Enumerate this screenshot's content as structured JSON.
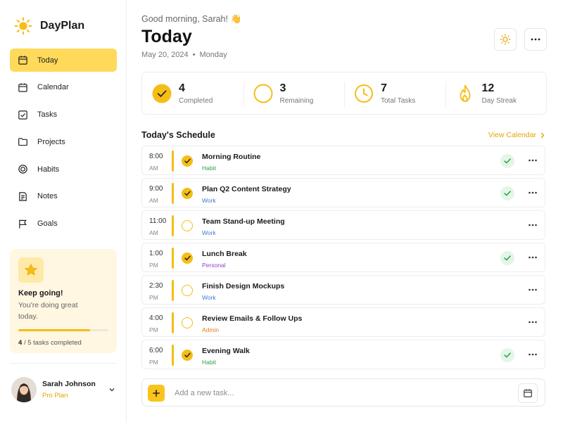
{
  "app": {
    "name": "DayPlan",
    "logo_icon": "sun-icon",
    "accent": "#F5BD16",
    "active_bg": "#FFD95A"
  },
  "sidebar": {
    "items": [
      {
        "label": "Today",
        "icon": "calendar-icon",
        "active": true
      },
      {
        "label": "Calendar",
        "icon": "calendar-icon",
        "active": false
      },
      {
        "label": "Tasks",
        "icon": "checkbox-icon",
        "active": false
      },
      {
        "label": "Projects",
        "icon": "folder-icon",
        "active": false
      },
      {
        "label": "Habits",
        "icon": "target-icon",
        "active": false
      },
      {
        "label": "Notes",
        "icon": "note-icon",
        "active": false
      },
      {
        "label": "Goals",
        "icon": "flag-icon",
        "active": false
      }
    ],
    "motivation": {
      "title": "Keep going!",
      "body": "You're doing great today.",
      "icon": "star-icon",
      "progress_done": "4",
      "progress_total": "5",
      "progress_suffix": "tasks completed",
      "progress_fraction": 0.8
    },
    "user": {
      "name": "Sarah Johnson",
      "plan": "Pro Plan"
    }
  },
  "header": {
    "greeting": "Good morning, Sarah! 👋",
    "title": "Today",
    "date": "May 20, 2024",
    "weekday": "Monday",
    "separator": "•"
  },
  "stats": [
    {
      "value": "4",
      "label": "Completed",
      "icon": "check-circle-icon"
    },
    {
      "value": "3",
      "label": "Remaining",
      "icon": "circle-icon"
    },
    {
      "value": "7",
      "label": "Total Tasks",
      "icon": "clock-icon"
    },
    {
      "value": "12",
      "label": "Day Streak",
      "icon": "flame-icon"
    }
  ],
  "schedule": {
    "title": "Today's Schedule",
    "view_link": "View Calendar",
    "rows": [
      {
        "time": "8:00",
        "ampm": "AM",
        "title": "Morning Routine",
        "tag": "Habit",
        "tag_color": "#2E9E48",
        "done": true
      },
      {
        "time": "9:00",
        "ampm": "AM",
        "title": "Plan Q2 Content Strategy",
        "tag": "Work",
        "tag_color": "#3A7BD5",
        "done": true
      },
      {
        "time": "11:00",
        "ampm": "AM",
        "title": "Team Stand-up Meeting",
        "tag": "Work",
        "tag_color": "#3A7BD5",
        "done": false
      },
      {
        "time": "1:00",
        "ampm": "PM",
        "title": "Lunch Break",
        "tag": "Personal",
        "tag_color": "#8E44C8",
        "done": true
      },
      {
        "time": "2:30",
        "ampm": "PM",
        "title": "Finish Design Mockups",
        "tag": "Work",
        "tag_color": "#3A7BD5",
        "done": false
      },
      {
        "time": "4:00",
        "ampm": "PM",
        "title": "Review Emails & Follow Ups",
        "tag": "Admin",
        "tag_color": "#E07B1F",
        "done": false
      },
      {
        "time": "6:00",
        "ampm": "PM",
        "title": "Evening Walk",
        "tag": "Habit",
        "tag_color": "#2E9E48",
        "done": true
      }
    ]
  },
  "add_task": {
    "placeholder": "Add a new task..."
  }
}
